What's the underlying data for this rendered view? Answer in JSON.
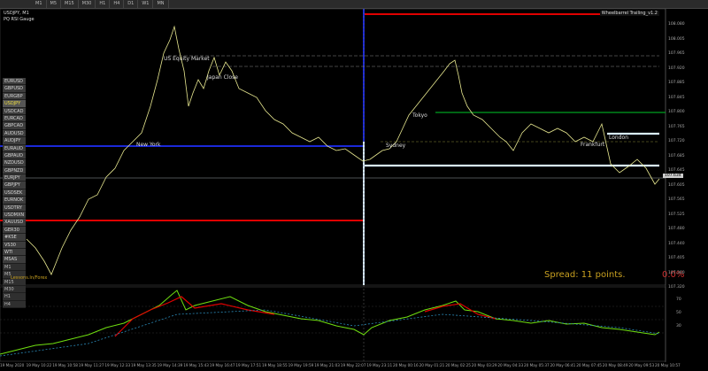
{
  "toolbar": {
    "timeframes": [
      "M1",
      "M5",
      "M15",
      "M30",
      "H1",
      "H4",
      "D1",
      "W1",
      "MN"
    ]
  },
  "chart": {
    "symbol_title": "USDJPY, M1",
    "indicator_title": "PQ RSI Gauge",
    "ea_label": "Wheelbarrel Trailing_v1.2",
    "spread_text": "Spread: 11 points.",
    "percent_text": "0.0%",
    "lessons_text": "Lessons.In/Forex",
    "current_price": "107.634",
    "sessions": [
      "US Equity Market",
      "Japan Close",
      "New York",
      "Tokyo",
      "Sydney",
      "London",
      "Frankfurt"
    ],
    "colors": {
      "red_line": "#e00000",
      "blue_line": "#1a28d8",
      "green_line": "#00a020",
      "white_band": "#d8ecff",
      "price_line": "#9aa0aa",
      "rsi_green": "#70e010",
      "rsi_yellow": "#e0e020",
      "rsi_red": "#e00000",
      "rsi_dotted": "#2a8ab8"
    }
  },
  "symbols": [
    "EURUSD",
    "GBPUSD",
    "EURGBP",
    "USDJPY",
    "USDCAD",
    "EURCAD",
    "GBPCAD",
    "AUDUSD",
    "AUDJPY",
    "EURAUD",
    "GBPAUD",
    "NZDUSD",
    "GBPNZD",
    "EURJPY",
    "GBPJPY",
    "USDSEK",
    "EURNOK",
    "USDTRY",
    "USDMXN",
    "XAUUSD",
    "GER30",
    "#KSE",
    "VS30",
    "WTI",
    "MSAS"
  ],
  "active_symbol": "USDJPY",
  "tf_buttons": [
    "M1",
    "M5",
    "M15",
    "M30",
    "H1",
    "H4"
  ],
  "price_axis": [
    "108.080",
    "108.005",
    "107.965",
    "107.920",
    "107.885",
    "107.845",
    "107.800",
    "107.765",
    "107.720",
    "107.685",
    "107.645",
    "107.605",
    "107.565",
    "107.525",
    "107.480",
    "107.440",
    "107.405",
    "107.360",
    "107.320"
  ],
  "rsi_axis": [
    "70",
    "50",
    "30"
  ],
  "time_axis": [
    "19 May 2020",
    "19 May 10:22",
    "19 May 10:58",
    "19 May 11:27",
    "19 May 12:33",
    "19 May 13:35",
    "19 May 14:39",
    "19 May 15:43",
    "19 May 16:47",
    "19 May 17:51",
    "19 May 18:55",
    "19 May 19:59",
    "19 May 21:03",
    "19 May 22:07",
    "19 May 23:11",
    "20 May 00:16",
    "20 May 01:21",
    "20 May 02:25",
    "20 May 03:29",
    "20 May 04:33",
    "20 May 05:37",
    "20 May 06:41",
    "20 May 07:45",
    "20 May 08:49",
    "20 May 09:53",
    "20 May 10:57"
  ]
}
